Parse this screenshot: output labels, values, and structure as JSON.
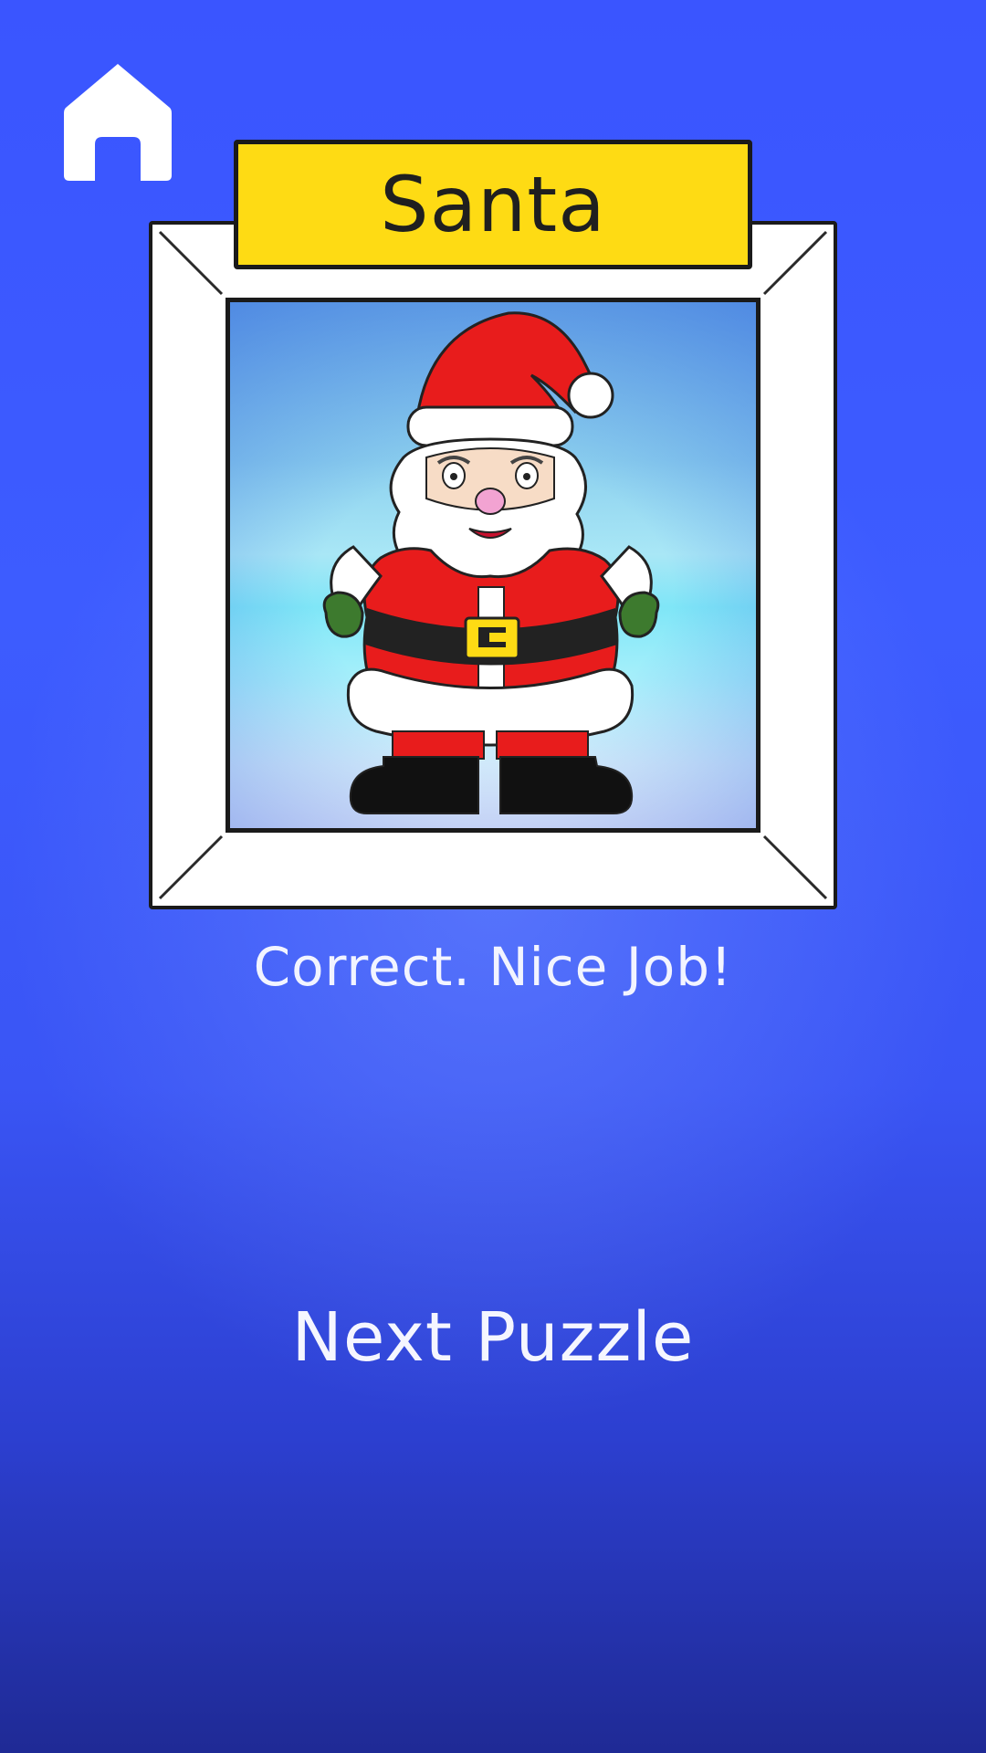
{
  "header": {
    "home_icon": "home-icon"
  },
  "puzzle": {
    "title": "Santa",
    "image": "santa-illustration"
  },
  "feedback": {
    "message": "Correct. Nice Job!"
  },
  "actions": {
    "next_label": "Next Puzzle"
  },
  "colors": {
    "background": "#3d5cff",
    "title_plate": "#fedb14",
    "frame": "#ffffff",
    "text": "#ffffff"
  }
}
